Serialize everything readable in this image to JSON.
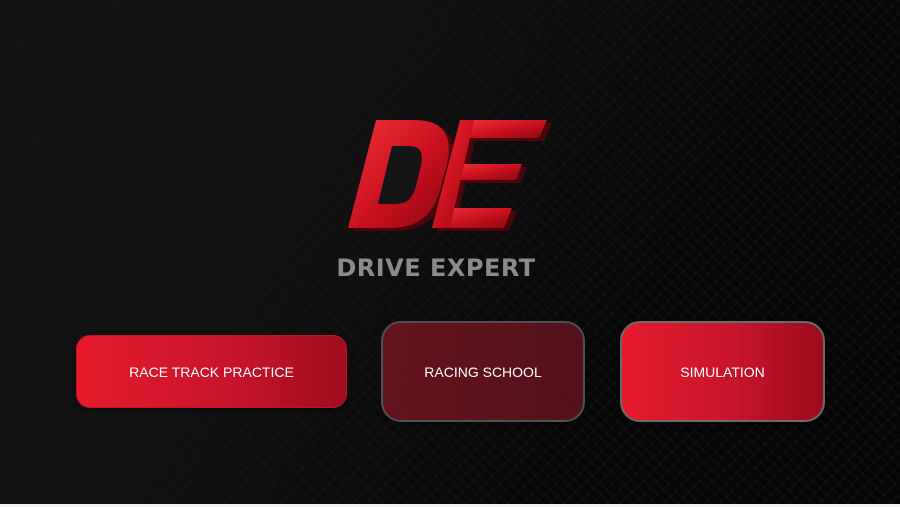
{
  "brand": {
    "logo_letters": "DE",
    "name": "DRIVE EXPERT"
  },
  "menu": {
    "buttons": [
      {
        "label": "RACE TRACK PRACTICE"
      },
      {
        "label": "RACING SCHOOL"
      },
      {
        "label": "SIMULATION"
      }
    ]
  },
  "colors": {
    "accent_red": "#e51b2c",
    "dark_red": "#a00d20",
    "brand_gray": "#8b8b8b",
    "background": "#1c1c1c"
  }
}
